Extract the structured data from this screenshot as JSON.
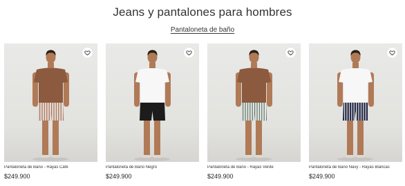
{
  "page": {
    "title": "Jeans y pantalones para hombres",
    "filter_label": "Pantaloneta de baño"
  },
  "colors": {
    "skin": "#b07a57",
    "hair": "#2a1f18"
  },
  "products": [
    {
      "name": "Pantaloneta de Baño - Rayas Café",
      "price": "$249.900",
      "shirt_color": "#8c5a3e",
      "shorts_color": "#e8dfd6",
      "shorts_pattern": "stripes-brown",
      "favorite_icon": "heart-icon"
    },
    {
      "name": "Pantaloneta de Baño Negro",
      "price": "$249.900",
      "shirt_color": "#f7f7f7",
      "shorts_color": "#1c1c1c",
      "shorts_pattern": "solid",
      "favorite_icon": "heart-icon"
    },
    {
      "name": "Pantaloneta de Baño - Rayas Verde",
      "price": "$249.900",
      "shirt_color": "#8c5a3e",
      "shorts_color": "#e6ebe6",
      "shorts_pattern": "stripes-green",
      "favorite_icon": "heart-icon"
    },
    {
      "name": "Pantaloneta de Baño Navy - Rayas Blancas",
      "price": "$249.900",
      "shirt_color": "#f7f7f7",
      "shorts_color": "#1f2540",
      "shorts_pattern": "stripes-white",
      "favorite_icon": "heart-icon"
    }
  ]
}
